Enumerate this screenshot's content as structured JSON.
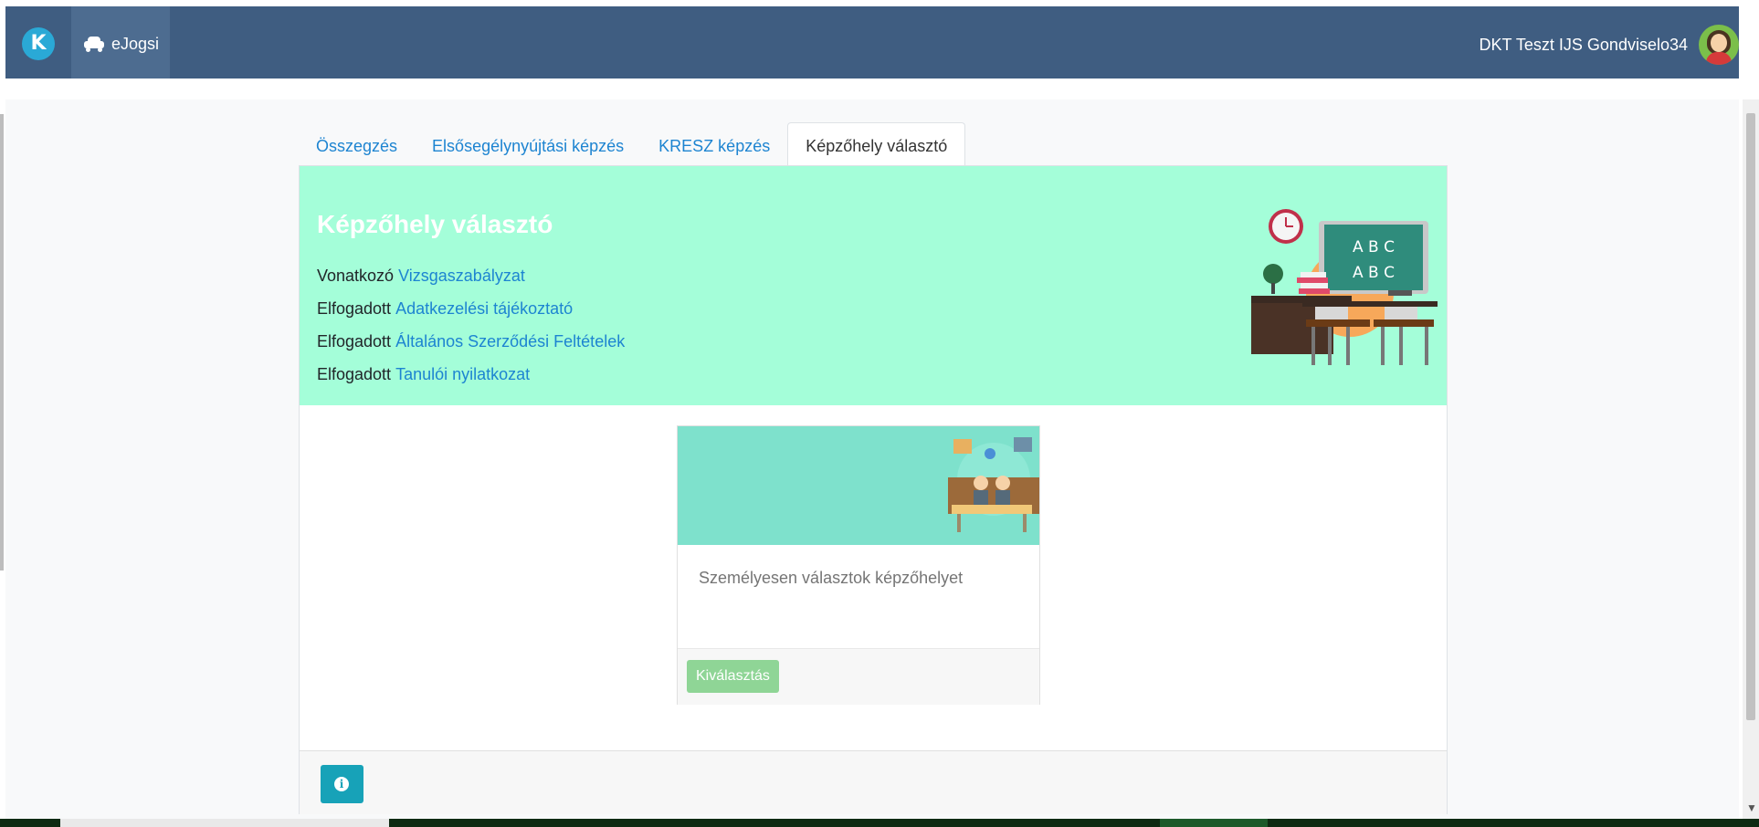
{
  "navbar": {
    "logo_letter": "K",
    "app_name": "eJogsi",
    "user_name": "DKT Teszt IJS Gondviselo34"
  },
  "tabs": [
    {
      "label": "Összegzés",
      "active": false
    },
    {
      "label": "Elsősegélynyújtási képzés",
      "active": false
    },
    {
      "label": "KRESZ képzés",
      "active": false
    },
    {
      "label": "Képzőhely választó",
      "active": true
    }
  ],
  "hero": {
    "title": "Képzőhely választó",
    "lines": [
      {
        "prefix": "Vonatkozó",
        "link": "Vizsgaszabályzat"
      },
      {
        "prefix": "Elfogadott",
        "link": "Adatkezelési tájékoztató"
      },
      {
        "prefix": "Elfogadott",
        "link": "Általános Szerződési Feltételek"
      },
      {
        "prefix": "Elfogadott",
        "link": "Tanulói nyilatkozat"
      }
    ],
    "board_text": [
      "A B C",
      "A B C"
    ]
  },
  "option": {
    "text": "Személyesen választok képzőhelyet",
    "button": "Kiválasztás"
  },
  "footer": {
    "info_icon": "info-icon"
  },
  "colors": {
    "navbar": "#3f5d81",
    "hero_bg": "#a4fed9",
    "link": "#1d84d1",
    "select_button": "#8fd596",
    "info_button": "#17a2b8"
  }
}
